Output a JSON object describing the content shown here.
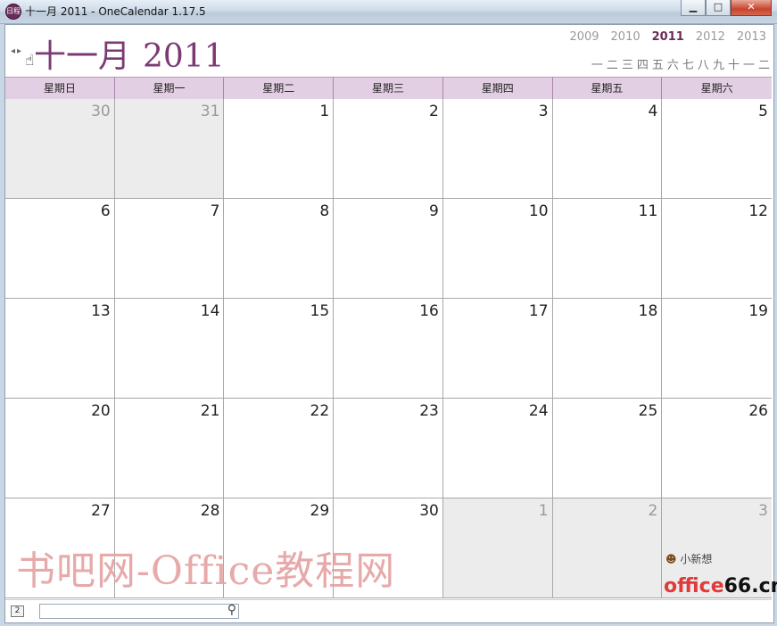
{
  "window": {
    "title": "十一月 2011 - OneCalendar 1.17.5",
    "icon_label": "日程",
    "controls": {
      "minimize": "▁",
      "maximize": "□",
      "close": "✕"
    }
  },
  "header": {
    "prev_label": "◂",
    "next_label": "▸",
    "month": "十一月",
    "year": "2011",
    "years": [
      "2009",
      "2010",
      "2011",
      "2012",
      "2013"
    ],
    "current_year": "2011",
    "months": [
      "一",
      "二",
      "三",
      "四",
      "五",
      "六",
      "七",
      "八",
      "九",
      "十",
      "一",
      "二"
    ]
  },
  "calendar": {
    "weekdays": [
      "星期日",
      "星期一",
      "星期二",
      "星期三",
      "星期四",
      "星期五",
      "星期六"
    ],
    "weeks": [
      [
        {
          "n": "30",
          "o": true
        },
        {
          "n": "31",
          "o": true
        },
        {
          "n": "1"
        },
        {
          "n": "2"
        },
        {
          "n": "3"
        },
        {
          "n": "4"
        },
        {
          "n": "5"
        }
      ],
      [
        {
          "n": "6"
        },
        {
          "n": "7"
        },
        {
          "n": "8"
        },
        {
          "n": "9"
        },
        {
          "n": "10"
        },
        {
          "n": "11"
        },
        {
          "n": "12"
        }
      ],
      [
        {
          "n": "13"
        },
        {
          "n": "14"
        },
        {
          "n": "15"
        },
        {
          "n": "16"
        },
        {
          "n": "17"
        },
        {
          "n": "18"
        },
        {
          "n": "19"
        }
      ],
      [
        {
          "n": "20"
        },
        {
          "n": "21"
        },
        {
          "n": "22"
        },
        {
          "n": "23"
        },
        {
          "n": "24"
        },
        {
          "n": "25"
        },
        {
          "n": "26"
        }
      ],
      [
        {
          "n": "27"
        },
        {
          "n": "28"
        },
        {
          "n": "29"
        },
        {
          "n": "30"
        },
        {
          "n": "1",
          "o": true
        },
        {
          "n": "2",
          "o": true
        },
        {
          "n": "3",
          "o": true
        }
      ]
    ]
  },
  "bottom": {
    "week_number": "2",
    "search_placeholder": ""
  },
  "overlays": {
    "watermark": "书吧网-Office教程网",
    "user_label": "小新想",
    "site_prefix": "office",
    "site_suffix": "66.cn"
  }
}
